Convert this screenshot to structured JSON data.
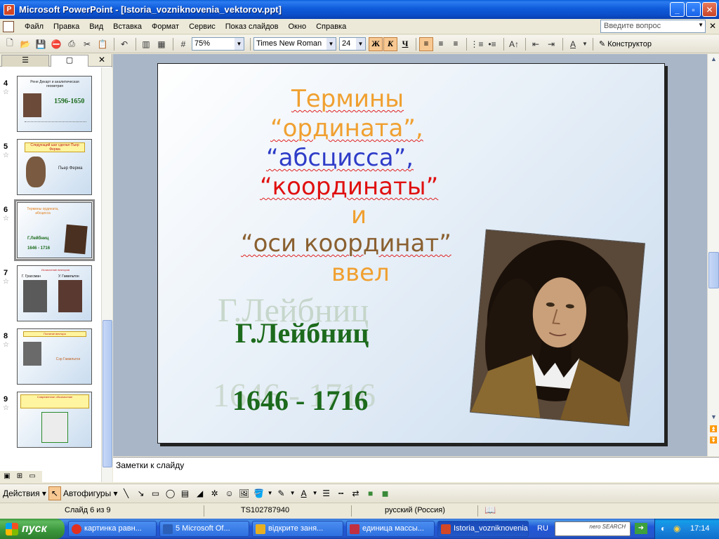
{
  "window": {
    "title": "Microsoft PowerPoint - [Istoria_vozniknovenia_vektorov.ppt]",
    "minimize": "_",
    "maximize": "▫",
    "close": "✕"
  },
  "menu": {
    "items": [
      "Файл",
      "Правка",
      "Вид",
      "Вставка",
      "Формат",
      "Сервис",
      "Показ слайдов",
      "Окно",
      "Справка"
    ],
    "help_placeholder": "Введите вопрос"
  },
  "toolbar": {
    "zoom": "75%",
    "font": "Times New Roman",
    "font_size": "24",
    "bold": "Ж",
    "italic": "К",
    "underline": "Ч",
    "designer": "Конструктор"
  },
  "slides_panel": {
    "thumbnails": [
      {
        "number": "4",
        "title": "Рене Декарт и аналитическая геометрия",
        "years": "1596-1650"
      },
      {
        "number": "5",
        "title": "Следующий шаг сделал Пьер Ферма",
        "name": "Пьер Ферма"
      },
      {
        "number": "6",
        "title": "Термины ордината, абсцисса",
        "name": "Г.Лейбниц",
        "years": "1646 - 1716"
      },
      {
        "number": "7",
        "title": "Исчисление векторов",
        "name_left": "Г. Грассман",
        "name_right": "У. Гамильтон"
      },
      {
        "number": "8",
        "title": "Понятие вектора",
        "name": "Сэр Гамильтон"
      },
      {
        "number": "9",
        "title": "Современное обозначение"
      }
    ]
  },
  "slide": {
    "line1": "Термины",
    "line2": "“ордината”,",
    "line3": "“абсцисса”,",
    "line4": "“координаты”",
    "line5": "и",
    "line6": "“оси координат”",
    "line7": "ввел",
    "name_shadow": "Г.Лейбниц",
    "name": "Г.Лейбниц",
    "years_shadow": "1646 - 1716",
    "years": "1646 - 1716"
  },
  "notes": {
    "placeholder": "Заметки к слайду"
  },
  "drawing": {
    "actions": "Действия",
    "autoshapes": "Автофигуры"
  },
  "status": {
    "slide": "Слайд 6 из 9",
    "design": "TS102787940",
    "language": "русский (Россия)"
  },
  "taskbar": {
    "start": "пуск",
    "tasks": [
      {
        "label": "картинка равн...",
        "color": "#E03020"
      },
      {
        "label": "5 Microsoft Of...",
        "color": "#2B5FB8"
      },
      {
        "label": "відкрите заня...",
        "color": "#E8B020"
      },
      {
        "label": "единица массы...",
        "color": "#C03040"
      },
      {
        "label": "Istoria_vozniknovenia...",
        "color": "#D24726"
      }
    ],
    "lang": "RU",
    "nero": "nero SEARCH",
    "time": "17:14"
  }
}
